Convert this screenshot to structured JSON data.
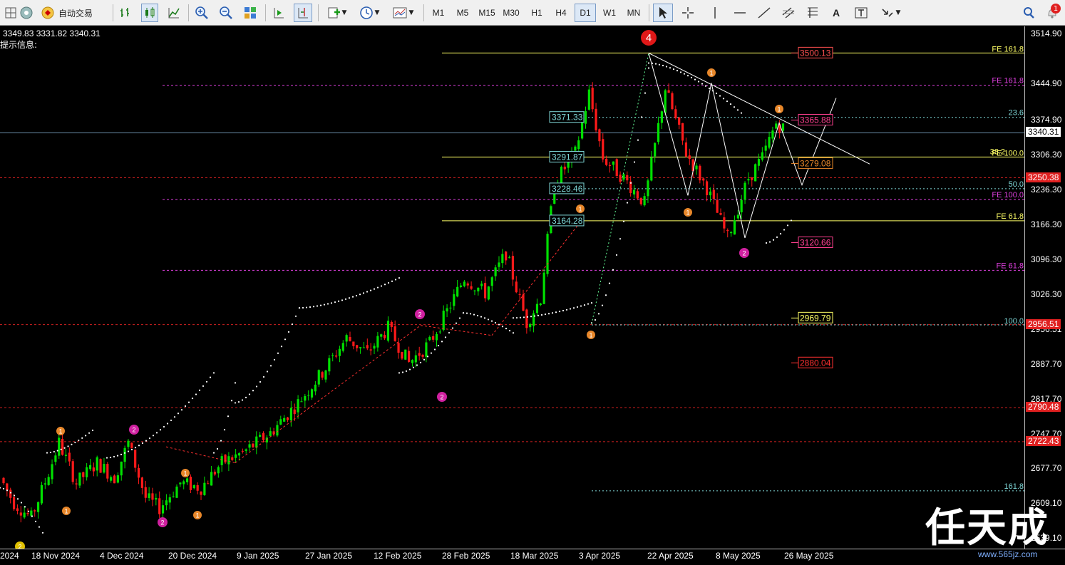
{
  "toolbar": {
    "auto_trade_label": "自动交易",
    "timeframes": [
      "M1",
      "M5",
      "M15",
      "M30",
      "H1",
      "H4",
      "D1",
      "W1",
      "MN"
    ],
    "active_timeframe": "D1",
    "text_tool_label": "A",
    "notification_count": "1"
  },
  "chart": {
    "ohlc_text": "3349.83 3331.82 3340.31",
    "hint_text": "提示信息:",
    "watermark": "任天成",
    "site": "www.565jz.com",
    "wave_label_top": "4",
    "current_price": "3340.31"
  },
  "price_axis": {
    "ticks": [
      "3514.90",
      "3444.90",
      "3374.90",
      "3306.30",
      "3236.30",
      "3166.30",
      "3096.30",
      "3026.30",
      "2956.51",
      "2887.70",
      "2817.70",
      "2747.70",
      "2677.70",
      "2609.10",
      "2539.10"
    ],
    "red_labels": [
      "3250.38",
      "2956.51",
      "2790.48",
      "2722.43"
    ]
  },
  "time_axis": {
    "labels": [
      "2024",
      "18 Nov 2024",
      "4 Dec 2024",
      "20 Dec 2024",
      "9 Jan 2025",
      "27 Jan 2025",
      "12 Feb 2025",
      "28 Feb 2025",
      "18 Mar 2025",
      "3 Apr 2025",
      "22 Apr 2025",
      "8 May 2025",
      "26 May 2025"
    ]
  },
  "levels": {
    "left_boxes": [
      "3371.33",
      "3291.87",
      "3228.46",
      "3164.28"
    ],
    "right_boxes": [
      "3500.13",
      "3365.88",
      "3279.08",
      "3120.66",
      "2969.79",
      "2880.04"
    ],
    "fe_labels": [
      "FE 161.8",
      "FE 161.8",
      "FE 100.0",
      "FE 100.0",
      "FE 61.8",
      "FE 61.8"
    ],
    "fib_labels": [
      "23.6",
      "50.0",
      "100.0",
      "161.8",
      "38.2"
    ]
  },
  "colors": {
    "bull": "#00e000",
    "bear": "#ff1a1a",
    "magenta": "#e040e0",
    "yellow": "#ffff66",
    "cyan": "#7fd8d8",
    "orange": "#e8872a"
  }
}
